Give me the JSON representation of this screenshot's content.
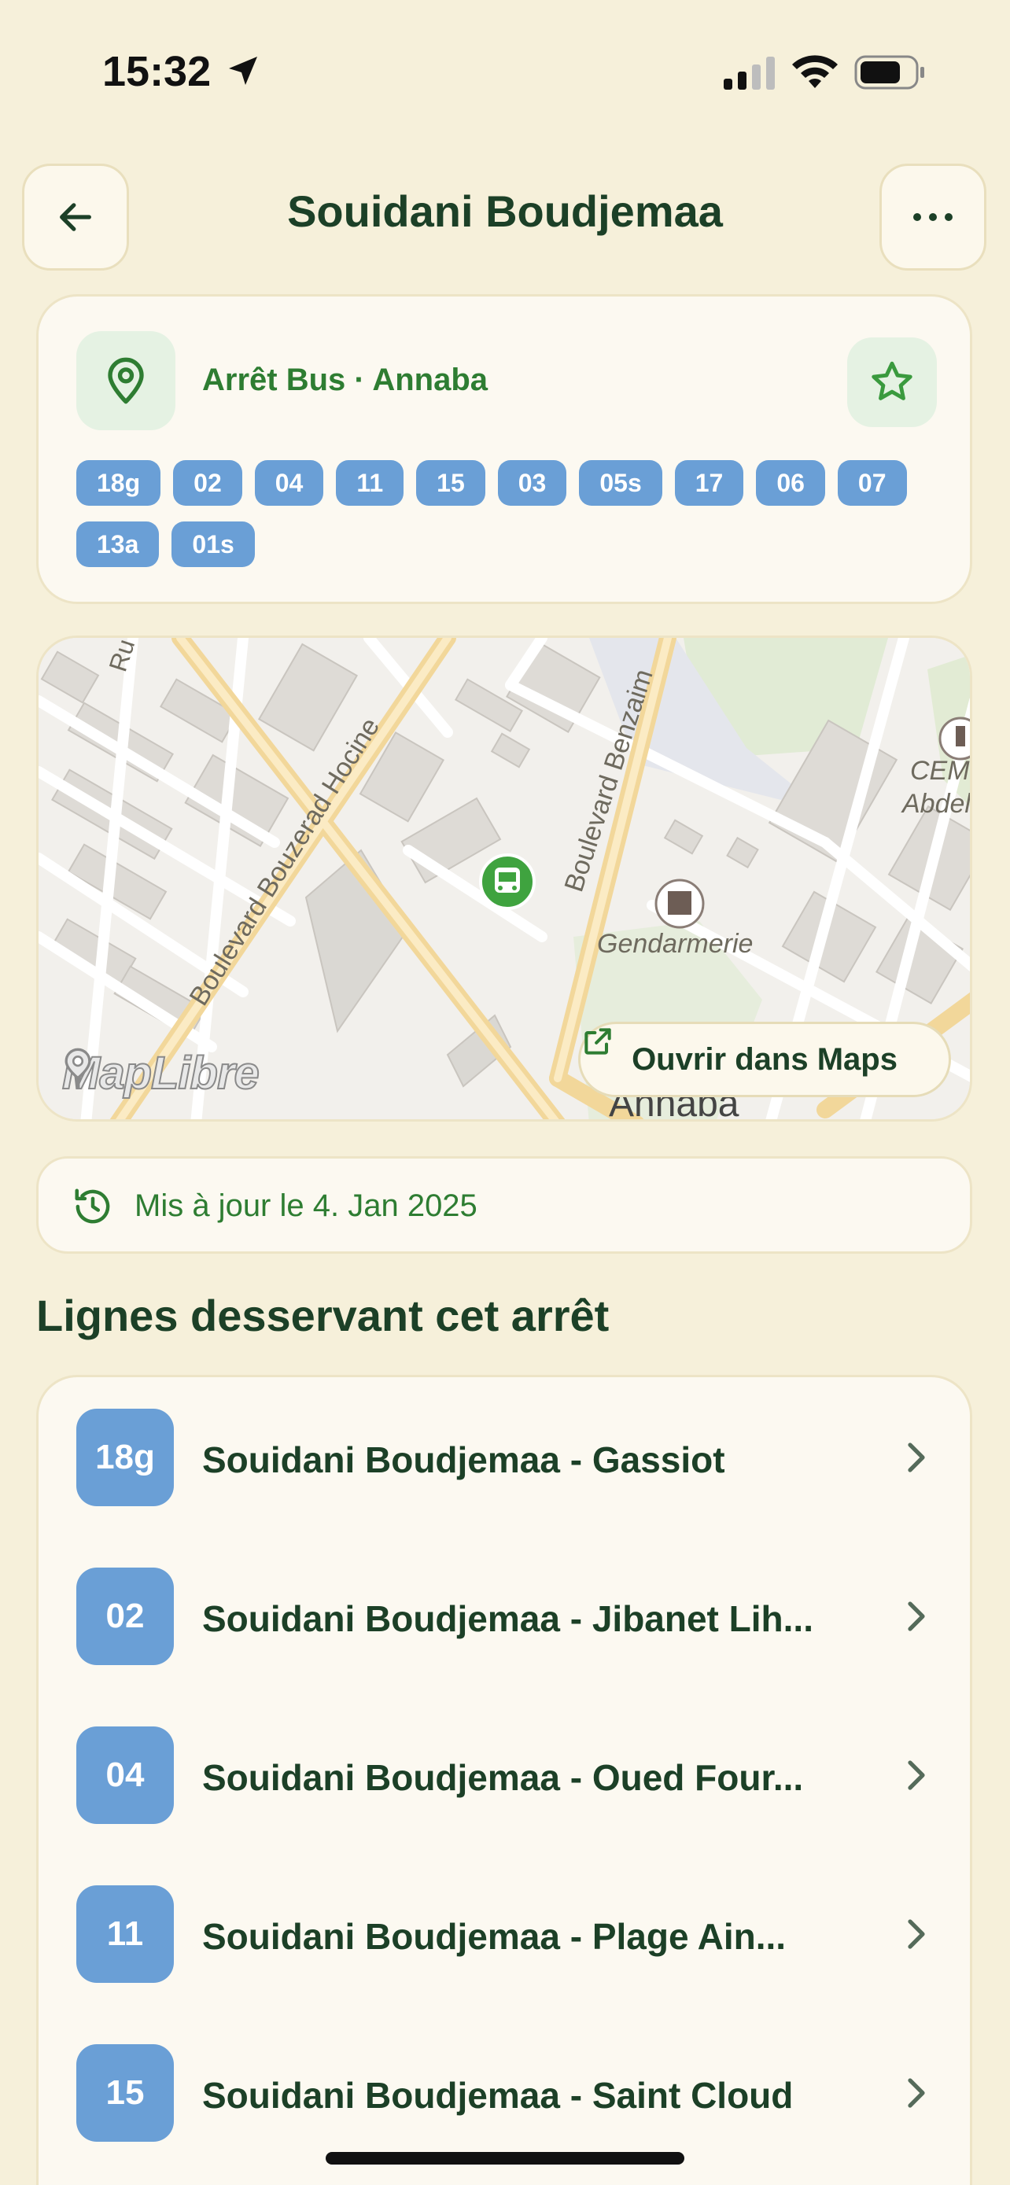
{
  "status_bar": {
    "time": "15:32"
  },
  "header": {
    "title": "Souidani Boudjemaa"
  },
  "stop": {
    "type_label": "Arrêt Bus · Annaba",
    "routes": [
      "18g",
      "02",
      "04",
      "11",
      "15",
      "03",
      "05s",
      "17",
      "06",
      "07",
      "13a",
      "01s"
    ]
  },
  "map": {
    "attribution": "MapLibre",
    "open_button": "Ouvrir dans Maps",
    "labels": {
      "boulevard_1": "Boulevard Bouzerad Hocine",
      "boulevard_2": "Boulevard Benzaim",
      "gendarmerie": "Gendarmerie",
      "cem_1": "CEM",
      "cem_2": "Abdel",
      "city": "Annaba",
      "street": "Ru"
    }
  },
  "updated": {
    "text": "Mis à jour le 4. Jan 2025"
  },
  "lines_section": {
    "title": "Lignes desservant cet arrêt",
    "items": [
      {
        "code": "18g",
        "name": "Souidani Boudjemaa - Gassiot"
      },
      {
        "code": "02",
        "name": "Souidani Boudjemaa - Jibanet Lih..."
      },
      {
        "code": "04",
        "name": "Souidani Boudjemaa - Oued Four..."
      },
      {
        "code": "11",
        "name": "Souidani Boudjemaa - Plage Ain..."
      },
      {
        "code": "15",
        "name": "Souidani Boudjemaa - Saint Cloud"
      }
    ]
  },
  "colors": {
    "background": "#F6F0DA",
    "card": "#FCF9F1",
    "primary_green": "#2E7D32",
    "text_dark": "#1C4027",
    "route_blue": "#6A9FD6"
  }
}
